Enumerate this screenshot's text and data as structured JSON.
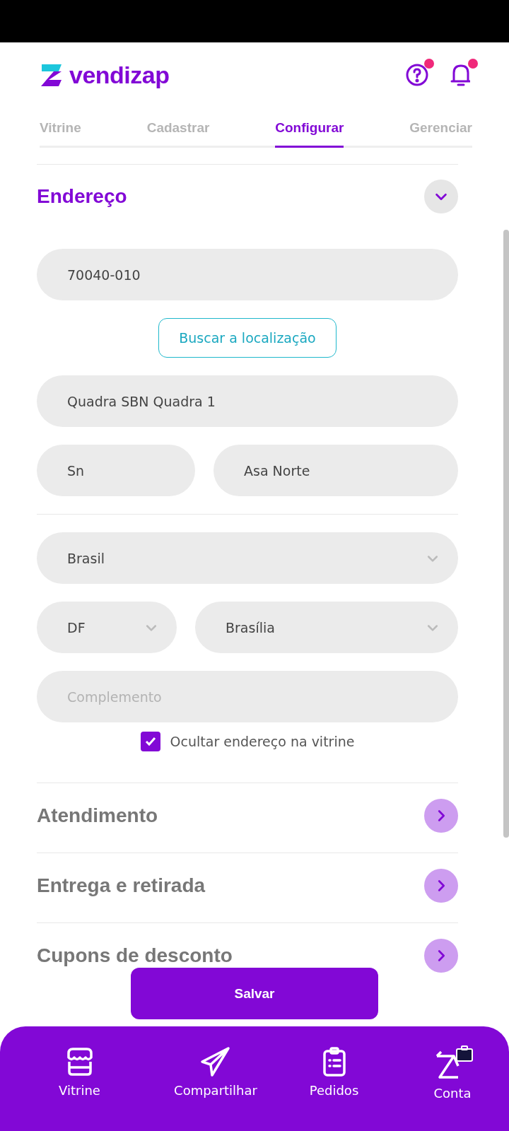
{
  "header": {
    "logo": "vendizap",
    "help_badge": true,
    "bell_badge": true
  },
  "tabs": [
    {
      "label": "Vitrine",
      "selected": false
    },
    {
      "label": "Cadastrar",
      "selected": false
    },
    {
      "label": "Configurar",
      "selected": true
    },
    {
      "label": "Gerenciar",
      "selected": false
    }
  ],
  "address": {
    "title": "Endereço",
    "expanded": true,
    "cep": {
      "value": "70040-010"
    },
    "search_button": "Buscar a localização",
    "street": {
      "value": "Quadra SBN Quadra 1"
    },
    "number": {
      "value": "Sn"
    },
    "district": {
      "value": "Asa Norte"
    },
    "country": {
      "value": "Brasil"
    },
    "state": {
      "value": "DF"
    },
    "city": {
      "value": "Brasília"
    },
    "complement": {
      "placeholder": "Complemento"
    },
    "hide_address": {
      "label": "Ocultar endereço na vitrine",
      "checked": true
    }
  },
  "sections": [
    {
      "title": "Atendimento",
      "expanded": false
    },
    {
      "title": "Entrega e retirada",
      "expanded": false
    },
    {
      "title": "Cupons de desconto",
      "expanded": false
    }
  ],
  "save_button": "Salvar",
  "bottom_nav": [
    {
      "label": "Vitrine"
    },
    {
      "label": "Compartilhar"
    },
    {
      "label": "Pedidos"
    },
    {
      "label": "Conta"
    }
  ]
}
